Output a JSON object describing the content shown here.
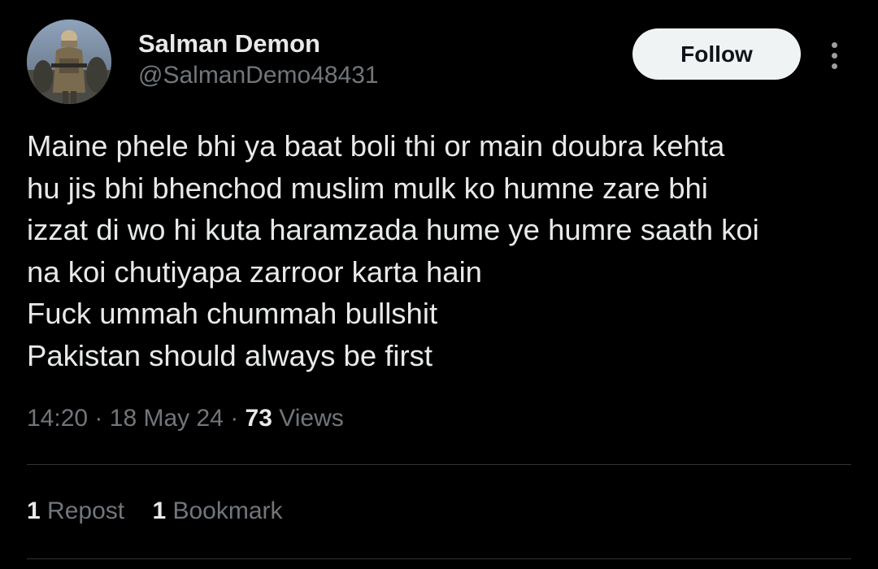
{
  "author": {
    "display_name": "Salman Demon",
    "handle": "@SalmanDemo48431"
  },
  "follow_label": "Follow",
  "more_icon": "more-vertical-icon",
  "tweet": {
    "lines": [
      "Maine phele bhi ya baat boli thi or main doubra kehta",
      "hu jis bhi bhenchod muslim mulk ko humne zare bhi",
      "izzat di wo hi kuta haramzada hume ye humre saath koi",
      "na koi chutiyapa zarroor karta hain",
      "Fuck ummah chummah bullshit",
      "Pakistan should always be first"
    ]
  },
  "meta": {
    "time": "14:20",
    "separator": "·",
    "date": "18 May 24",
    "views_count": "73",
    "views_label": "Views"
  },
  "stats": {
    "reposts_count": "1",
    "reposts_label": "Repost",
    "bookmarks_count": "1",
    "bookmarks_label": "Bookmark"
  },
  "colors": {
    "background": "#000000",
    "primary_text": "#e7e9ea",
    "secondary_text": "#71767b",
    "divider": "#2f3336",
    "follow_button_bg": "#eff3f4"
  }
}
